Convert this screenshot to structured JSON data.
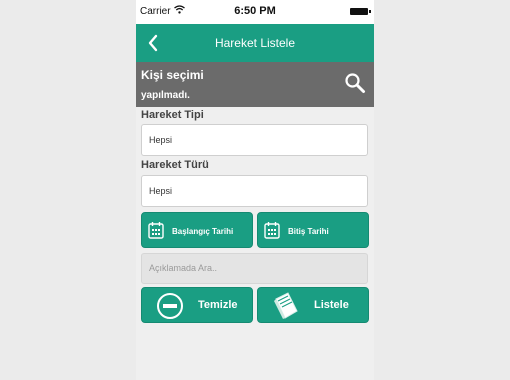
{
  "status": {
    "carrier": "Carrier",
    "time": "6:50 PM"
  },
  "nav": {
    "title": "Hareket Listele",
    "back_icon": "chevron-left-icon"
  },
  "search": {
    "line1": "Kişi seçimi",
    "line2": "yapılmadı.",
    "icon": "search-icon"
  },
  "hareket_tipi": {
    "label": "Hareket Tipi",
    "value": "Hepsi"
  },
  "hareket_turu": {
    "label": "Hareket Türü",
    "value": "Hepsi"
  },
  "dates": {
    "start_label": "Başlangıç Tarihi",
    "end_label": "Bitiş Tarihi",
    "icon": "calendar-icon"
  },
  "description": {
    "placeholder": "Açıklamada Ara.."
  },
  "actions": {
    "clear_label": "Temizle",
    "clear_icon": "minus-circle-icon",
    "list_label": "Listele",
    "list_icon": "document-icon"
  },
  "colors": {
    "accent": "#1a9e83",
    "search_bar": "#6b6b6b",
    "background": "#efefef"
  }
}
